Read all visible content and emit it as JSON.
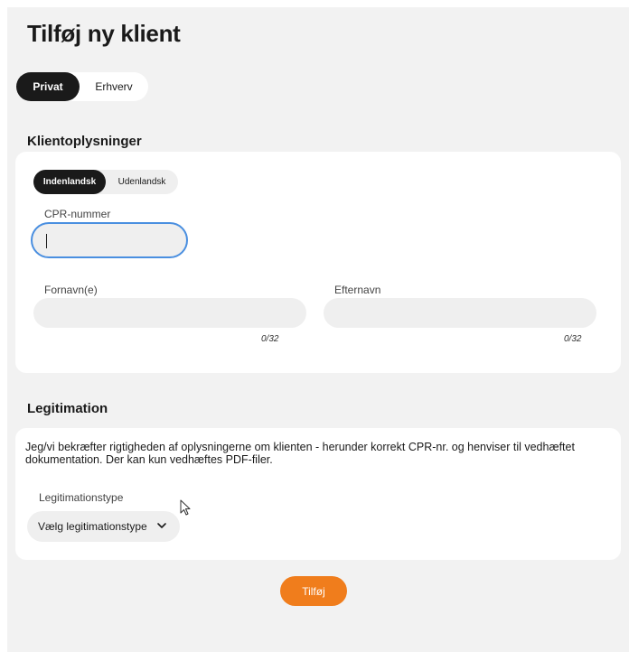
{
  "page": {
    "title": "Tilføj ny klient"
  },
  "client_type": {
    "options": [
      "Privat",
      "Erhverv"
    ],
    "selected": "Privat"
  },
  "client_info": {
    "heading": "Klientoplysninger",
    "origin": {
      "options": [
        "Indenlandsk",
        "Udenlandsk"
      ],
      "selected": "Indenlandsk"
    },
    "cpr": {
      "label": "CPR-nummer",
      "value": ""
    },
    "first_name": {
      "label": "Fornavn(e)",
      "value": "",
      "counter": "0/32"
    },
    "last_name": {
      "label": "Efternavn",
      "value": "",
      "counter": "0/32"
    }
  },
  "legitimation": {
    "heading": "Legitimation",
    "description": "Jeg/vi bekræfter rigtigheden af oplysningerne om klienten - herunder korrekt CPR-nr. og henviser til vedhæftet dokumentation. Der kan kun vedhæftes PDF-filer.",
    "type_label": "Legitimationstype",
    "type_select": "Vælg legitimationstype"
  },
  "actions": {
    "submit_label": "Tilføj"
  },
  "colors": {
    "accent": "#f07d1c",
    "dark": "#1a1a1a",
    "focus": "#4a8fe0",
    "background": "#f2f2f2"
  },
  "icons": {
    "select": "chevron-down-icon",
    "pointer": "mouse-pointer-icon"
  }
}
